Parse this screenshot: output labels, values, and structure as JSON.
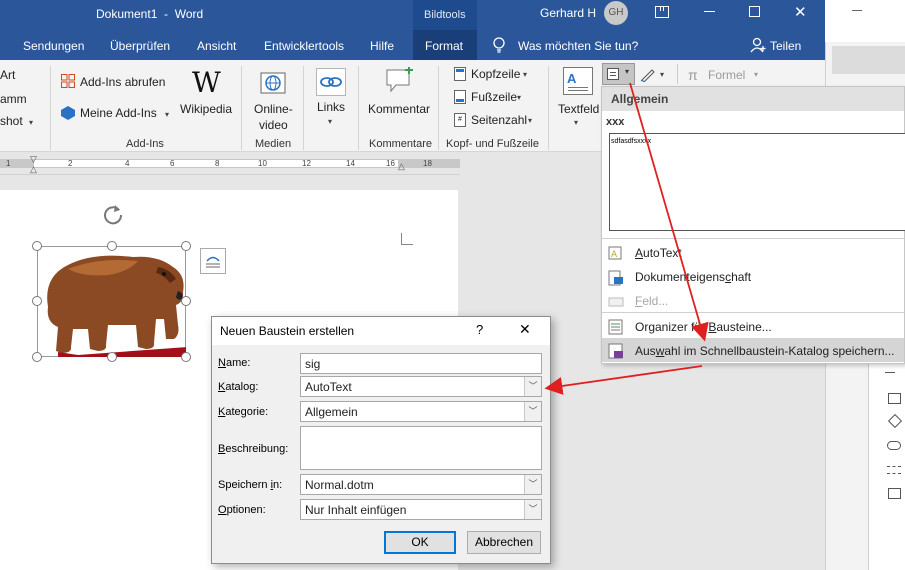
{
  "title_bar": {
    "doc_title": "Dokument1",
    "separator": "-",
    "app_name": "Word",
    "context_group": "Bildtools",
    "user_name": "Gerhard H",
    "user_initials": "GH"
  },
  "tabs": [
    "Sendungen",
    "Überprüfen",
    "Ansicht",
    "Entwicklertools",
    "Hilfe",
    "Format"
  ],
  "tell_me": "Was möchten Sie tun?",
  "share_label": "Teilen",
  "ribbon": {
    "partial_left": [
      "Art",
      "amm",
      "shot"
    ],
    "addins": {
      "get_addins": "Add-Ins abrufen",
      "my_addins": "Meine Add-Ins",
      "wikipedia": "Wikipedia",
      "group": "Add-Ins"
    },
    "media": {
      "online_video_1": "Online-",
      "online_video_2": "video",
      "group": "Medien"
    },
    "links": {
      "label": "Links"
    },
    "comments": {
      "label": "Kommentar",
      "group": "Kommentare"
    },
    "header_footer": {
      "header": "Kopfzeile",
      "footer": "Fußzeile",
      "page_number": "Seitenzahl",
      "group": "Kopf- und Fußzeile"
    },
    "textfield": {
      "label": "Textfeld"
    },
    "formula": {
      "label": "Formel"
    }
  },
  "ruler": {
    "marks": [
      "1",
      "2",
      "4",
      "6",
      "8",
      "10",
      "12",
      "14",
      "16",
      "18"
    ]
  },
  "menu": {
    "header": "Allgemein",
    "entry_name": "xxx",
    "preview_text": "sdfasdfsxxxx",
    "items": [
      {
        "pre": "",
        "u": "A",
        "post": "utoText",
        "enabled": true
      },
      {
        "pre": "Dokumenteigens",
        "u": "c",
        "post": "haft",
        "enabled": true
      },
      {
        "pre": "",
        "u": "F",
        "post": "eld...",
        "enabled": false
      },
      {
        "pre": "Organizer für ",
        "u": "B",
        "post": "austeine...",
        "enabled": true
      },
      {
        "pre": "Aus",
        "u": "w",
        "post": "ahl im Schnellbaustein-Katalog speichern...",
        "enabled": true
      }
    ]
  },
  "dialog": {
    "title": "Neuen Baustein erstellen",
    "help": "?",
    "close": "✕",
    "fields": {
      "name": {
        "u": "N",
        "rest": "ame:",
        "value": "sig"
      },
      "gallery": {
        "u": "K",
        "rest": "atalog:",
        "value": "AutoText"
      },
      "category": {
        "pre": "",
        "u": "K",
        "rest": "ategorie:",
        "value": "Allgemein"
      },
      "description": {
        "u": "B",
        "rest": "eschreibung:",
        "value": ""
      },
      "save_in": {
        "pre": "Speichern ",
        "u": "i",
        "rest": "n:",
        "value": "Normal.dotm"
      },
      "options": {
        "u": "O",
        "rest": "ptionen:",
        "value": "Nur Inhalt einfügen"
      }
    },
    "ok": "OK",
    "cancel": "Abbrechen"
  },
  "colors": {
    "word_blue": "#2b579a",
    "arrow_red": "#e02020",
    "selected_menu": "#d5d5d5"
  },
  "icons": [
    "gear-rotate-icon",
    "layout-options-icon",
    "addins-store-icon",
    "wikipedia-icon",
    "online-video-icon",
    "links-icon",
    "comment-icon",
    "header-icon",
    "footer-icon",
    "page-number-icon",
    "textfield-icon",
    "quickparts-icon",
    "signature-icon",
    "formula-icon",
    "autotext-icon",
    "docproperty-icon",
    "field-icon",
    "organizer-icon",
    "save-gallery-icon"
  ]
}
